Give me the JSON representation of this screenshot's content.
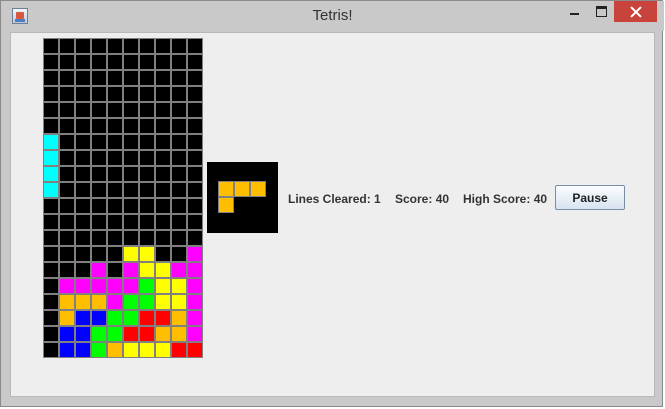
{
  "window": {
    "title": "Tetris!",
    "icon": "java-app-icon",
    "controls": [
      "minimize-icon",
      "maximize-icon",
      "close-icon"
    ],
    "close_color": "#c8433b"
  },
  "board": {
    "columns": 10,
    "rows": 20,
    "empty_color": "#000000",
    "grid_color": "#808080",
    "palette": {
      "C": "#00ffff",
      "M": "#ff00ff",
      "Y": "#ffff00",
      "O": "#ffbf00",
      "B": "#0000ff",
      "G": "#00ff00",
      "R": "#ff0000"
    },
    "cells": [
      "..........",
      "..........",
      "..........",
      "..........",
      "..........",
      "..........",
      "C.........",
      "C.........",
      "C.........",
      "C.........",
      "..........",
      "..........",
      "..........",
      ".....YY..M",
      "...M.MYYMM",
      ".MMMMMGYYM",
      ".OOOMGGYYM",
      ".OBBGGRROM",
      ".BBGGRROOM",
      ".BBGOYYYRR"
    ]
  },
  "next_piece": {
    "color": "#ffbf00",
    "cells": [
      "OOO",
      "O.."
    ]
  },
  "stats": {
    "lines_label": "Lines Cleared:",
    "lines": "1",
    "score_label": "Score:",
    "score": "40",
    "high_label": "High Score:",
    "high": "40"
  },
  "pause_label": "Pause"
}
